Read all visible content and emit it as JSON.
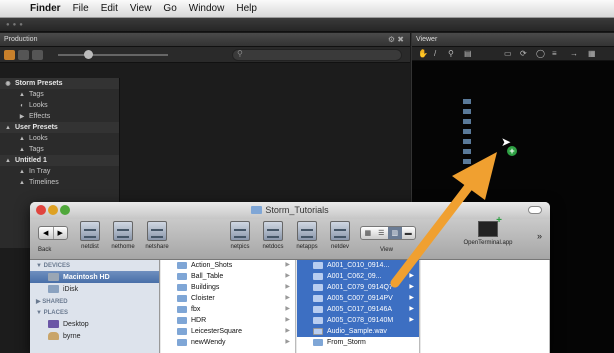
{
  "menubar": {
    "items": [
      "Finder",
      "File",
      "Edit",
      "View",
      "Go",
      "Window",
      "Help"
    ]
  },
  "production": {
    "title": "Production",
    "sidebar": [
      {
        "type": "header",
        "label": "Storm Presets"
      },
      {
        "type": "item",
        "label": "Tags",
        "icon": "tag-icon"
      },
      {
        "type": "item",
        "label": "Looks",
        "icon": "looks-icon"
      },
      {
        "type": "item",
        "label": "Effects",
        "icon": "effects-icon"
      },
      {
        "type": "header",
        "label": "User Presets"
      },
      {
        "type": "item",
        "label": "Looks",
        "icon": "looks-icon"
      },
      {
        "type": "item",
        "label": "Tags",
        "icon": "tag-icon"
      },
      {
        "type": "header",
        "label": "Untitled 1"
      },
      {
        "type": "item",
        "label": "In Tray",
        "icon": "tray-icon"
      },
      {
        "type": "item",
        "label": "Timelines",
        "icon": "timeline-icon"
      }
    ]
  },
  "viewer": {
    "title": "Viewer"
  },
  "finder": {
    "title": "Storm_Tutorials",
    "toolbar": {
      "back_label": "Back",
      "left_drives": [
        "netdist",
        "nethome",
        "netshare"
      ],
      "right_drives": [
        "netpics",
        "netdocs",
        "netapps",
        "netdev"
      ],
      "view_label": "View",
      "terminal_label": "OpenTerminal.app"
    },
    "sidebar": {
      "devices_header": "▼ DEVICES",
      "devices": [
        "Macintosh HD",
        "iDisk"
      ],
      "shared_header": "▶ SHARED",
      "places_header": "▼ PLACES",
      "places": [
        "Desktop",
        "byrne"
      ]
    },
    "column1": [
      "Action_Shots",
      "Ball_Table",
      "Buildings",
      "Cloister",
      "fbx",
      "HDR",
      "LeicesterSquare",
      "newWendy"
    ],
    "column2": [
      {
        "name": "A001_C010_0914...",
        "selected": true
      },
      {
        "name": "A001_C062_09...",
        "selected": true
      },
      {
        "name": "A001_C079_0914Q7",
        "selected": true
      },
      {
        "name": "A005_C007_0914PV",
        "selected": true
      },
      {
        "name": "A005_C017_09146A",
        "selected": true
      },
      {
        "name": "A005_C078_09140M",
        "selected": true
      },
      {
        "name": "Audio_Sample.wav",
        "selected": true
      },
      {
        "name": "From_Storm",
        "selected": false
      }
    ]
  }
}
